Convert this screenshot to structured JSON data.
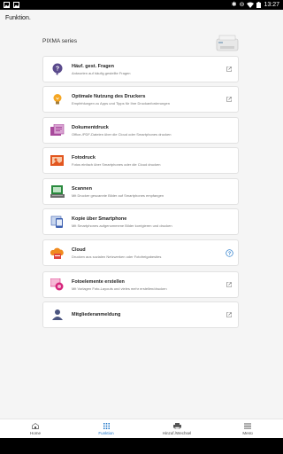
{
  "status": {
    "time": "13:27"
  },
  "header": {
    "title": "Funktion."
  },
  "section": {
    "label": "PIXMA series"
  },
  "cards": [
    {
      "title": "Häuf. gest. Fragen",
      "subtitle": "Antworten auf häufig gestellte Fragen",
      "icon": "question-icon",
      "action": "external-link-icon"
    },
    {
      "title": "Optimale Nutzung des Druckers",
      "subtitle": "Empfehlungen zu Apps und Tipps für Ihre Druckanforderungen",
      "icon": "lightbulb-icon",
      "action": "external-link-icon"
    },
    {
      "title": "Dokumentdruck",
      "subtitle": "Office-/PDF-Dateien über die Cloud oder Smartphones drucken",
      "icon": "document-print-icon",
      "action": ""
    },
    {
      "title": "Fotodruck",
      "subtitle": "Fotos einfach über Smartphones oder die Cloud drucken",
      "icon": "photo-print-icon",
      "action": ""
    },
    {
      "title": "Scannen",
      "subtitle": "Mit Drucker gescannte Bilder auf Smartphones empfangen",
      "icon": "scan-icon",
      "action": ""
    },
    {
      "title": "Kopie über Smartphone",
      "subtitle": "Mit Smartphones aufgenommene Bilder korrigieren und drucken",
      "icon": "smartphone-copy-icon",
      "action": ""
    },
    {
      "title": "Cloud",
      "subtitle": "Drucken aus sozialen Netzwerken oder Fotofreigabesites",
      "icon": "cloud-print-icon",
      "action": "help-icon"
    },
    {
      "title": "Fotoelemente erstellen",
      "subtitle": "Mit Vorlagen Foto-Layouts und vieles mehr erstellen/drucken",
      "icon": "photo-items-icon",
      "action": "external-link-icon"
    },
    {
      "title": "Mitgliederanmeldung",
      "subtitle": "",
      "icon": "member-icon",
      "action": "external-link-icon"
    }
  ],
  "nav": [
    {
      "label": "Home",
      "icon": "home-icon"
    },
    {
      "label": "Funktion",
      "icon": "grid-icon"
    },
    {
      "label": "Hinzuf./Wechsel",
      "icon": "printer-icon"
    },
    {
      "label": "Menü",
      "icon": "menu-icon"
    }
  ],
  "colors": {
    "accent": "#1a73c7",
    "card_border": "#e2e2e2",
    "background": "#f5f5f5"
  }
}
